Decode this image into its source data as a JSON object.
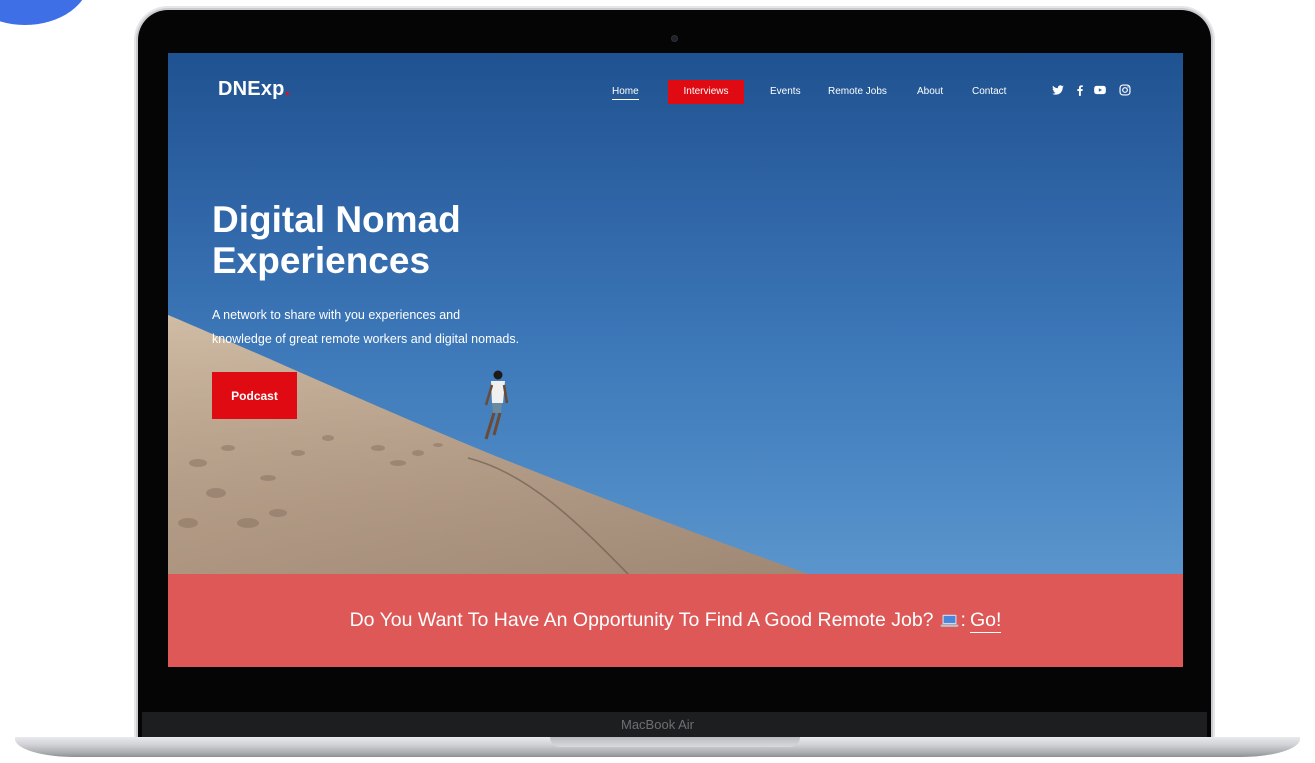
{
  "device": {
    "label": "MacBook Air"
  },
  "site": {
    "logo_text": "DNExp",
    "logo_dot": ".",
    "nav": [
      {
        "label": "Home",
        "active": true
      },
      {
        "label": "Interviews",
        "highlight": true
      },
      {
        "label": "Events"
      },
      {
        "label": "Remote Jobs"
      },
      {
        "label": "About"
      },
      {
        "label": "Contact"
      }
    ],
    "social_icons": [
      "twitter-icon",
      "facebook-icon",
      "youtube-icon",
      "instagram-icon"
    ],
    "hero": {
      "title_line1": "Digital Nomad",
      "title_line2": "Experiences",
      "subtitle_line1": "A network to share with you experiences and",
      "subtitle_line2": "knowledge of great remote workers and digital nomads.",
      "cta_label": "Podcast"
    },
    "banner": {
      "text": "Do You Want To Have An Opportunity To Find A Good Remote Job?",
      "separator": ":",
      "link_label": "Go!"
    }
  },
  "colors": {
    "accent_red": "#e00b12",
    "banner_bg": "#de5858",
    "sky": "#3c77b8",
    "blob": "#3f6fe6"
  }
}
